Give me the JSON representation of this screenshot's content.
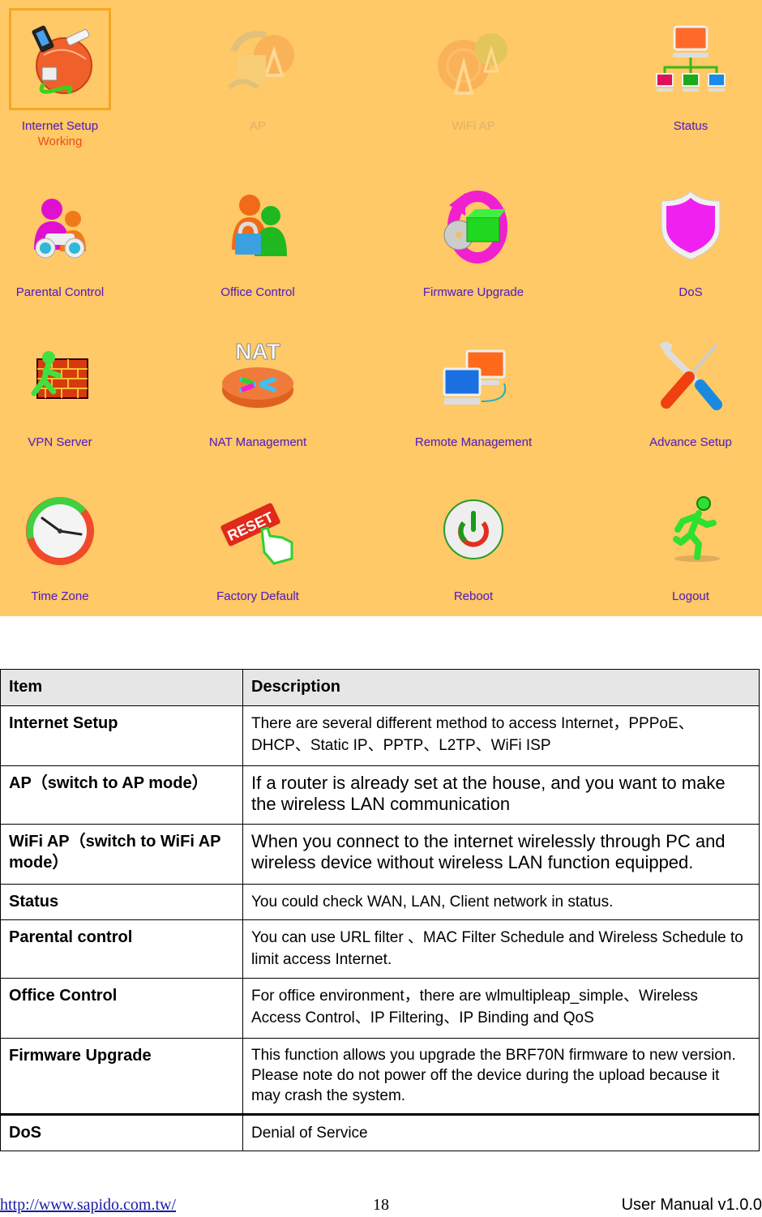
{
  "menu": {
    "tiles": [
      {
        "label": "Internet Setup",
        "sub": "Working",
        "icon": "internet-setup-globe-icon",
        "state": "selected"
      },
      {
        "label": "AP",
        "icon": "ap-antenna-icon",
        "state": "disabled"
      },
      {
        "label": "WiFi AP",
        "icon": "wifi-ap-antenna-icon",
        "state": "disabled"
      },
      {
        "label": "Status",
        "icon": "network-status-icon",
        "state": "normal"
      },
      {
        "label": "Parental Control",
        "icon": "parental-binoculars-icon",
        "state": "normal"
      },
      {
        "label": "Office Control",
        "icon": "office-users-lock-icon",
        "state": "normal"
      },
      {
        "label": "Firmware Upgrade",
        "icon": "firmware-box-disc-icon",
        "state": "normal"
      },
      {
        "label": "DoS",
        "icon": "shield-icon",
        "state": "normal"
      },
      {
        "label": "VPN Server",
        "icon": "firewall-runner-icon",
        "state": "normal"
      },
      {
        "label": "NAT Management",
        "icon": "nat-router-icon",
        "state": "normal"
      },
      {
        "label": "Remote Management",
        "icon": "remote-computers-icon",
        "state": "normal"
      },
      {
        "label": "Advance Setup",
        "icon": "wrench-screwdriver-icon",
        "state": "normal"
      },
      {
        "label": "Time Zone",
        "icon": "clock-icon",
        "state": "normal"
      },
      {
        "label": "Factory Default",
        "icon": "reset-button-hand-icon",
        "state": "normal"
      },
      {
        "label": "Reboot",
        "icon": "power-icon",
        "state": "normal"
      },
      {
        "label": "Logout",
        "icon": "running-man-icon",
        "state": "normal"
      }
    ],
    "colors": {
      "background": "#fec966",
      "label": "#5a22b8",
      "working": "#f04a1a",
      "selected_border": "#f5a623"
    }
  },
  "table": {
    "headers": [
      "Item",
      "Description"
    ],
    "rows": [
      {
        "item": "Internet Setup",
        "description": "There are several different method to access Internet，PPPoE、DHCP、Static IP、PPTP、L2TP、WiFi ISP"
      },
      {
        "item": "AP（switch to AP mode）",
        "description": "If a router is already set at the house, and you want to make the wireless LAN communication"
      },
      {
        "item": "WiFi AP（switch to WiFi AP mode）",
        "description": "When you connect to the internet wirelessly through PC and wireless device without wireless LAN function equipped."
      },
      {
        "item": "Status",
        "description": "You could check WAN, LAN, Client network in status."
      },
      {
        "item": "Parental control",
        "description": "You can use URL filter  、MAC Filter Schedule and Wireless Schedule to limit access Internet."
      },
      {
        "item": "Office Control",
        "description": "For office environment，there are wlmultipleap_simple、Wireless Access Control、IP Filtering、IP Binding and QoS"
      },
      {
        "item": "Firmware Upgrade",
        "description": "This function allows you upgrade the BRF70N firmware to new version. Please note do not power off the device during the upload because it may crash the system."
      },
      {
        "item": "DoS",
        "description": "Denial of Service"
      }
    ]
  },
  "footer": {
    "url": "http://www.sapido.com.tw/",
    "page": "18",
    "manual": "User  Manual  v1.0.0"
  }
}
